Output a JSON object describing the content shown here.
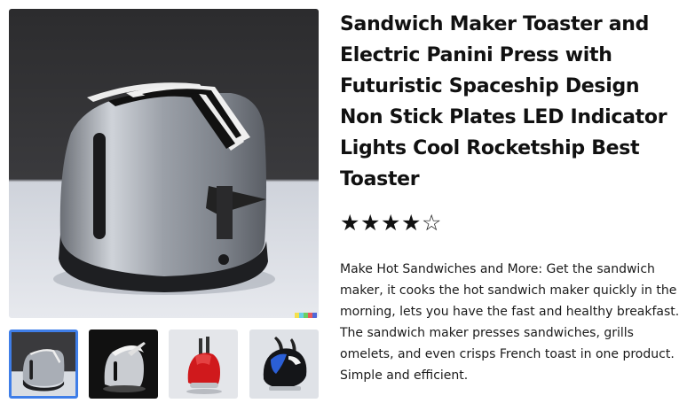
{
  "product": {
    "title": "Sandwich Maker Toaster and Electric Panini Press with Futuristic Spaceship Design Non Stick Plates LED Indicator Lights Cool Rocketship Best Toaster",
    "rating": {
      "value": 4,
      "max": 5,
      "filled_glyph": "★",
      "empty_glyph": "☆"
    },
    "description": "Make Hot Sandwiches and More: Get the  sandwich maker, it cooks the hot sandwich maker quickly in the morning, lets you have the fast and healthy breakfast. The sandwich maker presses sandwiches, grills omelets, and even crisps French toast in one product. Simple and efficient."
  },
  "gallery": {
    "selected_index": 0,
    "thumbnails": [
      {
        "icon": "silver-toaster-image"
      },
      {
        "icon": "dark-silver-toaster-image"
      },
      {
        "icon": "red-toaster-image"
      },
      {
        "icon": "black-blue-toaster-image"
      }
    ],
    "selected_border_color": "#3f7ee8"
  }
}
